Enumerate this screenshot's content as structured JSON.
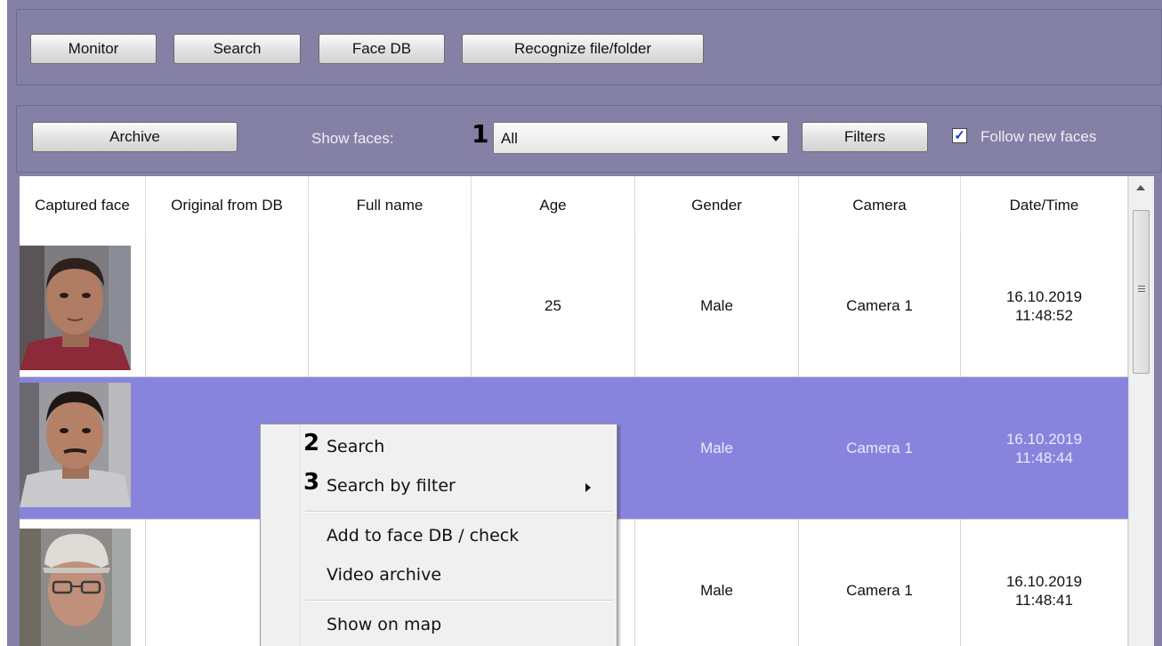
{
  "nav": {
    "monitor": "Monitor",
    "search": "Search",
    "face_db": "Face DB",
    "recognize": "Recognize file/folder"
  },
  "toolbar": {
    "archive": "Archive",
    "show_faces_label": "Show faces:",
    "callout_1": "1",
    "show_faces_value": "All",
    "filters": "Filters",
    "follow_checked": true,
    "follow_label": "Follow new faces"
  },
  "table": {
    "headers": [
      "Captured face",
      "Original from DB",
      "Full name",
      "Age",
      "Gender",
      "Camera",
      "Date/Time"
    ],
    "rows": [
      {
        "original": "",
        "full_name": "",
        "age": "25",
        "gender": "Male",
        "camera": "Camera 1",
        "date": "16.10.2019",
        "time": "11:48:52",
        "selected": false
      },
      {
        "original": "",
        "full_name": "",
        "age": "",
        "gender": "Male",
        "camera": "Camera 1",
        "date": "16.10.2019",
        "time": "11:48:44",
        "selected": true
      },
      {
        "original": "",
        "full_name": "",
        "age": "",
        "gender": "Male",
        "camera": "Camera 1",
        "date": "16.10.2019",
        "time": "11:48:41",
        "selected": false
      }
    ]
  },
  "context_menu": {
    "callout_2": "2",
    "callout_3": "3",
    "search": "Search",
    "search_by_filter": "Search by filter",
    "add_to_face_db": "Add to face DB / check",
    "video_archive": "Video archive",
    "show_on_map": "Show on map"
  },
  "colors": {
    "panel_bg": "#8580a6",
    "selected_row": "#8884de"
  }
}
